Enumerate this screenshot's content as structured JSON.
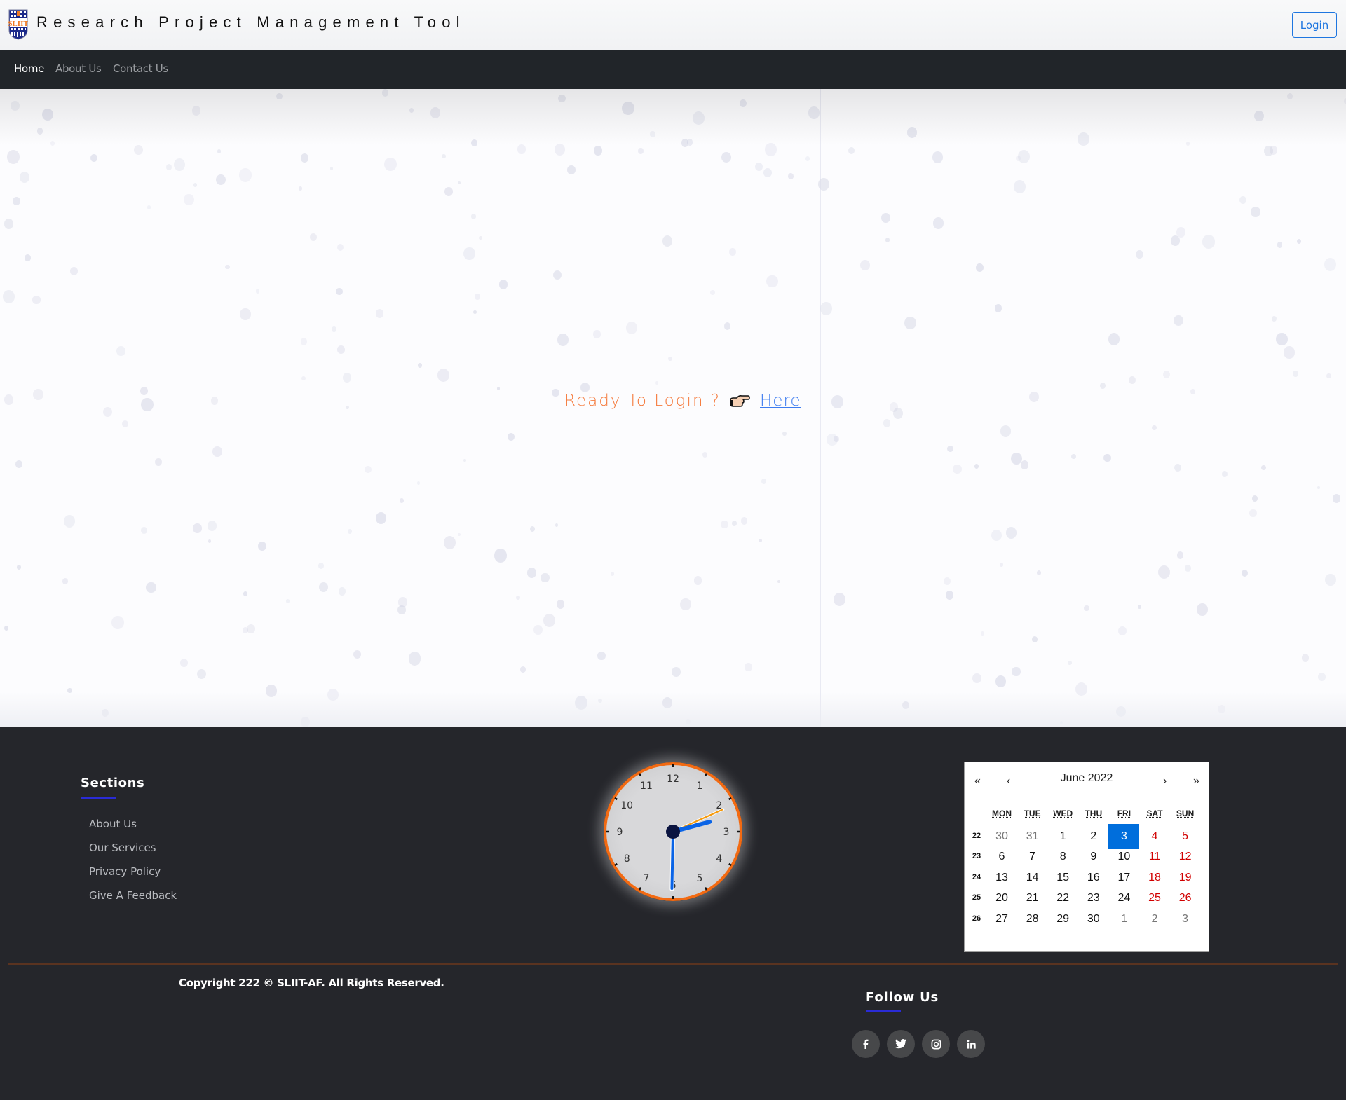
{
  "header": {
    "title": "Research Project Management Tool",
    "logo": "sliit-logo",
    "login_label": "Login"
  },
  "nav": {
    "items": [
      {
        "label": "Home",
        "active": true
      },
      {
        "label": "About Us",
        "active": false
      },
      {
        "label": "Contact Us",
        "active": false
      }
    ]
  },
  "hero": {
    "prompt": "Ready To Login ?",
    "icon": "pointing-hand-icon",
    "link_label": "Here"
  },
  "footer": {
    "sections": {
      "heading": "Sections",
      "links": [
        "About Us",
        "Our Services",
        "Privacy Policy",
        "Give A Feedback"
      ]
    },
    "clock": {
      "numerals": [
        "12",
        "1",
        "2",
        "3",
        "4",
        "5",
        "6",
        "7",
        "8",
        "9",
        "10",
        "11"
      ],
      "time": {
        "hours": 2,
        "minutes": 30,
        "seconds": 11
      }
    },
    "calendar": {
      "nav": {
        "prev_year": "«",
        "prev_month": "‹",
        "next_month": "›",
        "next_year": "»"
      },
      "title": "June 2022",
      "weekdays": [
        "MON",
        "TUE",
        "WED",
        "THU",
        "FRI",
        "SAT",
        "SUN"
      ],
      "weeks": [
        {
          "week": "22",
          "days": [
            {
              "d": "30",
              "t": "other"
            },
            {
              "d": "31",
              "t": "other"
            },
            {
              "d": "1"
            },
            {
              "d": "2"
            },
            {
              "d": "3",
              "t": "selected"
            },
            {
              "d": "4",
              "t": "weekend"
            },
            {
              "d": "5",
              "t": "weekend"
            }
          ]
        },
        {
          "week": "23",
          "days": [
            {
              "d": "6"
            },
            {
              "d": "7"
            },
            {
              "d": "8"
            },
            {
              "d": "9"
            },
            {
              "d": "10"
            },
            {
              "d": "11",
              "t": "weekend"
            },
            {
              "d": "12",
              "t": "weekend"
            }
          ]
        },
        {
          "week": "24",
          "days": [
            {
              "d": "13"
            },
            {
              "d": "14"
            },
            {
              "d": "15"
            },
            {
              "d": "16"
            },
            {
              "d": "17"
            },
            {
              "d": "18",
              "t": "weekend"
            },
            {
              "d": "19",
              "t": "weekend"
            }
          ]
        },
        {
          "week": "25",
          "days": [
            {
              "d": "20"
            },
            {
              "d": "21"
            },
            {
              "d": "22"
            },
            {
              "d": "23"
            },
            {
              "d": "24"
            },
            {
              "d": "25",
              "t": "weekend"
            },
            {
              "d": "26",
              "t": "weekend"
            }
          ]
        },
        {
          "week": "26",
          "days": [
            {
              "d": "27"
            },
            {
              "d": "28"
            },
            {
              "d": "29"
            },
            {
              "d": "30"
            },
            {
              "d": "1",
              "t": "other"
            },
            {
              "d": "2",
              "t": "other"
            },
            {
              "d": "3",
              "t": "other"
            }
          ]
        }
      ]
    },
    "copyright": "Copyright 222 © SLIIT-AF. All Rights Reserved.",
    "follow": {
      "heading": "Follow Us",
      "socials": [
        {
          "name": "facebook-icon",
          "glyph": "f"
        },
        {
          "name": "twitter-icon",
          "glyph": "tw"
        },
        {
          "name": "instagram-icon",
          "glyph": "ig"
        },
        {
          "name": "linkedin-icon",
          "glyph": "in"
        }
      ]
    }
  },
  "colors": {
    "accent_orange": "#f57c3f",
    "link_blue": "#3d7cf0",
    "login_blue": "#1e76e0",
    "nav_bg": "#212529",
    "footer_bg": "#25262b",
    "underline_blue": "#2a2bd6",
    "clock_ring": "#f26a12",
    "calendar_selected": "#006edc",
    "calendar_weekend": "#d10000"
  }
}
